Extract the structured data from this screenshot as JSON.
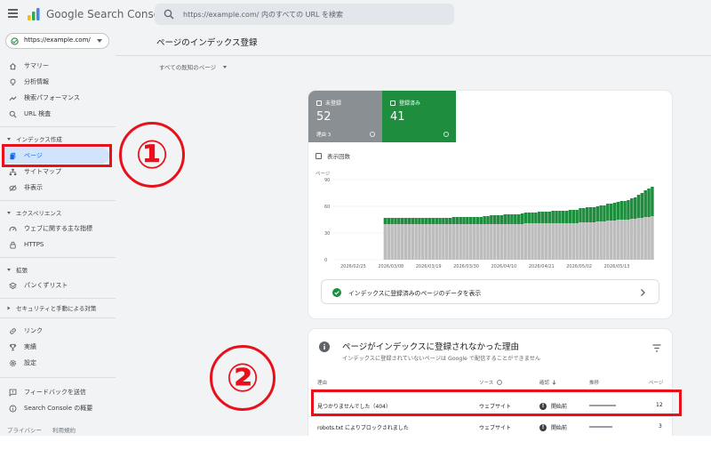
{
  "header": {
    "brand": "Google Search Console",
    "search_placeholder": "https://example.com/ 内のすべての URL を検索"
  },
  "property": {
    "label": "https://example.com/"
  },
  "sidebar": {
    "items": [
      {
        "label": "サマリー",
        "icon": "home-icon"
      },
      {
        "label": "分析情報",
        "icon": "lightbulb-icon"
      },
      {
        "label": "検索パフォーマンス",
        "icon": "trending-icon"
      },
      {
        "label": "URL 検査",
        "icon": "search-icon"
      }
    ],
    "sections": {
      "index": "インデックス作成",
      "experience": "エクスペリエンス",
      "enhancements": "拡張",
      "security": "セキュリティと手動による対策"
    },
    "index_items": [
      {
        "label": "ページ",
        "icon": "pages-icon",
        "active": true
      },
      {
        "label": "サイトマップ",
        "icon": "sitemap-icon"
      },
      {
        "label": "非表示",
        "icon": "hidden-icon"
      }
    ],
    "experience_items": [
      {
        "label": "ウェブに関する主な指標",
        "icon": "speed-icon"
      },
      {
        "label": "HTTPS",
        "icon": "lock-icon"
      }
    ],
    "enhancement_items": [
      {
        "label": "パンくずリスト",
        "icon": "layers-icon"
      }
    ],
    "bottom_items": [
      {
        "label": "リンク",
        "icon": "link-icon"
      },
      {
        "label": "実績",
        "icon": "trophy-icon"
      },
      {
        "label": "設定",
        "icon": "gear-icon"
      }
    ],
    "footer_items": [
      {
        "label": "フィードバックを送信",
        "icon": "feedback-icon"
      },
      {
        "label": "Search Console の概要",
        "icon": "info-icon"
      }
    ],
    "links": {
      "privacy": "プライバシー",
      "terms": "利用規約"
    }
  },
  "main": {
    "title": "ページのインデックス登録",
    "filter": "すべての既知のページ",
    "tiles": {
      "not_indexed": {
        "label": "未登録",
        "value": "52",
        "sub": "理由 3",
        "color": "#8a8f93"
      },
      "indexed": {
        "label": "登録済み",
        "value": "41",
        "color": "#1e8e3e"
      }
    },
    "impressions_label": "表示回数",
    "cta": "インデックスに登録済みのページのデータを表示",
    "reasons": {
      "title": "ページがインデックスに登録されなかった理由",
      "subtitle": "インデックスに登録されていないページは Google で配信することができません",
      "headers": {
        "reason": "理由",
        "source": "ソース",
        "validation": "確認",
        "trend": "推移",
        "pages": "ページ"
      },
      "rows": [
        {
          "reason": "見つかりませんでした（404）",
          "source": "ウェブサイト",
          "status": "開始前",
          "pages": "12"
        },
        {
          "reason": "robots.txt によりブロックされました",
          "source": "ウェブサイト",
          "status": "開始前",
          "pages": "3"
        }
      ]
    }
  },
  "annotations": {
    "marker1": "①",
    "marker2": "②",
    "color": "#e8101a"
  },
  "chart_data": {
    "type": "bar",
    "title": "",
    "ylabel": "ページ",
    "xlabel": "",
    "ylim": [
      0,
      90
    ],
    "yticks": [
      0,
      30,
      60,
      90
    ],
    "tick_labels": [
      "2026/02/25",
      "2026/03/08",
      "2026/03/19",
      "2026/03/30",
      "2026/04/10",
      "2026/04/21",
      "2026/05/02",
      "2026/05/13"
    ],
    "tick_positions": [
      0,
      11,
      22,
      33,
      44,
      55,
      66,
      77
    ],
    "total_points": 88,
    "data_start": 9,
    "series": [
      {
        "name": "未登録",
        "color": "#bdbdbd",
        "values": [
          0,
          0,
          0,
          0,
          0,
          0,
          0,
          0,
          0,
          40,
          40,
          40,
          40,
          40,
          40,
          40,
          40,
          40,
          40,
          40,
          40,
          40,
          40,
          40,
          40,
          40,
          40,
          40,
          40,
          40,
          40,
          40,
          40,
          40,
          40,
          40,
          40,
          40,
          40,
          40,
          40,
          40,
          40,
          40,
          40,
          40,
          40,
          40,
          40,
          40,
          41,
          41,
          41,
          41,
          41,
          41,
          41,
          41,
          41,
          41,
          41,
          41,
          41,
          41,
          41,
          41,
          42,
          42,
          42,
          42,
          42,
          43,
          43,
          43,
          44,
          44,
          44,
          45,
          45,
          45,
          45,
          46,
          46,
          47,
          47,
          48,
          48,
          49
        ]
      },
      {
        "name": "登録済み",
        "color": "#1e8e3e",
        "values": [
          0,
          0,
          0,
          0,
          0,
          0,
          0,
          0,
          0,
          7,
          7,
          7,
          7,
          7,
          7,
          7,
          7,
          7,
          7,
          7,
          7,
          7,
          7,
          7,
          7,
          7,
          7,
          7,
          7,
          8,
          8,
          8,
          8,
          8,
          8,
          8,
          8,
          8,
          9,
          9,
          10,
          10,
          10,
          10,
          11,
          11,
          11,
          11,
          11,
          12,
          12,
          12,
          12,
          12,
          13,
          13,
          13,
          13,
          14,
          14,
          14,
          14,
          14,
          15,
          15,
          15,
          16,
          16,
          17,
          17,
          17,
          17,
          18,
          18,
          19,
          19,
          20,
          20,
          21,
          21,
          22,
          23,
          24,
          26,
          28,
          30,
          32,
          33
        ]
      }
    ]
  }
}
